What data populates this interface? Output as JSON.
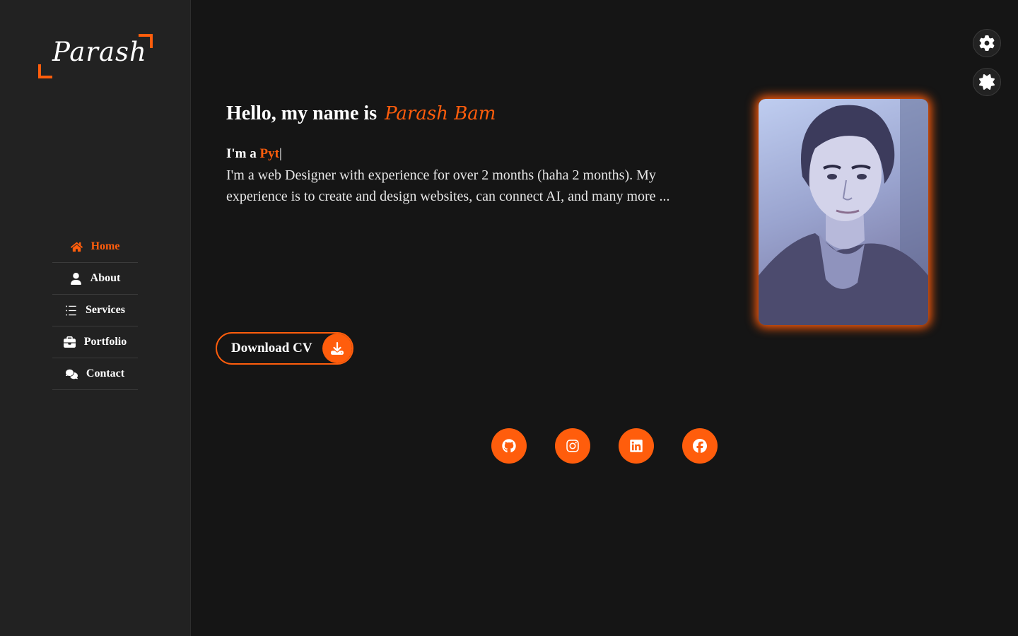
{
  "brand": {
    "logo_text": "Parash",
    "accent": "#ff5d0c"
  },
  "nav": {
    "items": [
      {
        "label": "Home",
        "icon": "home-icon",
        "active": true
      },
      {
        "label": "About",
        "icon": "user-icon",
        "active": false
      },
      {
        "label": "Services",
        "icon": "list-icon",
        "active": false
      },
      {
        "label": "Portfolio",
        "icon": "briefcase-icon",
        "active": false
      },
      {
        "label": "Contact",
        "icon": "comments-icon",
        "active": false
      }
    ]
  },
  "hero": {
    "greeting": "Hello, my name is",
    "name": "Parash Bam",
    "typing_prefix": "I'm a",
    "typing_text": "Pyt",
    "typing_cursor": "|",
    "description": "I'm a web Designer with experience for over 2 months (haha 2 months). My experience is to create and design websites, can connect AI, and many more ...",
    "download_label": "Download CV",
    "download_icon": "download-icon"
  },
  "socials": [
    {
      "name": "github",
      "icon": "github-icon"
    },
    {
      "name": "instagram",
      "icon": "instagram-icon"
    },
    {
      "name": "linkedin",
      "icon": "linkedin-icon"
    },
    {
      "name": "facebook",
      "icon": "facebook-icon"
    }
  ],
  "tools": {
    "settings_icon": "gear-icon",
    "theme_icon": "sun-icon"
  }
}
